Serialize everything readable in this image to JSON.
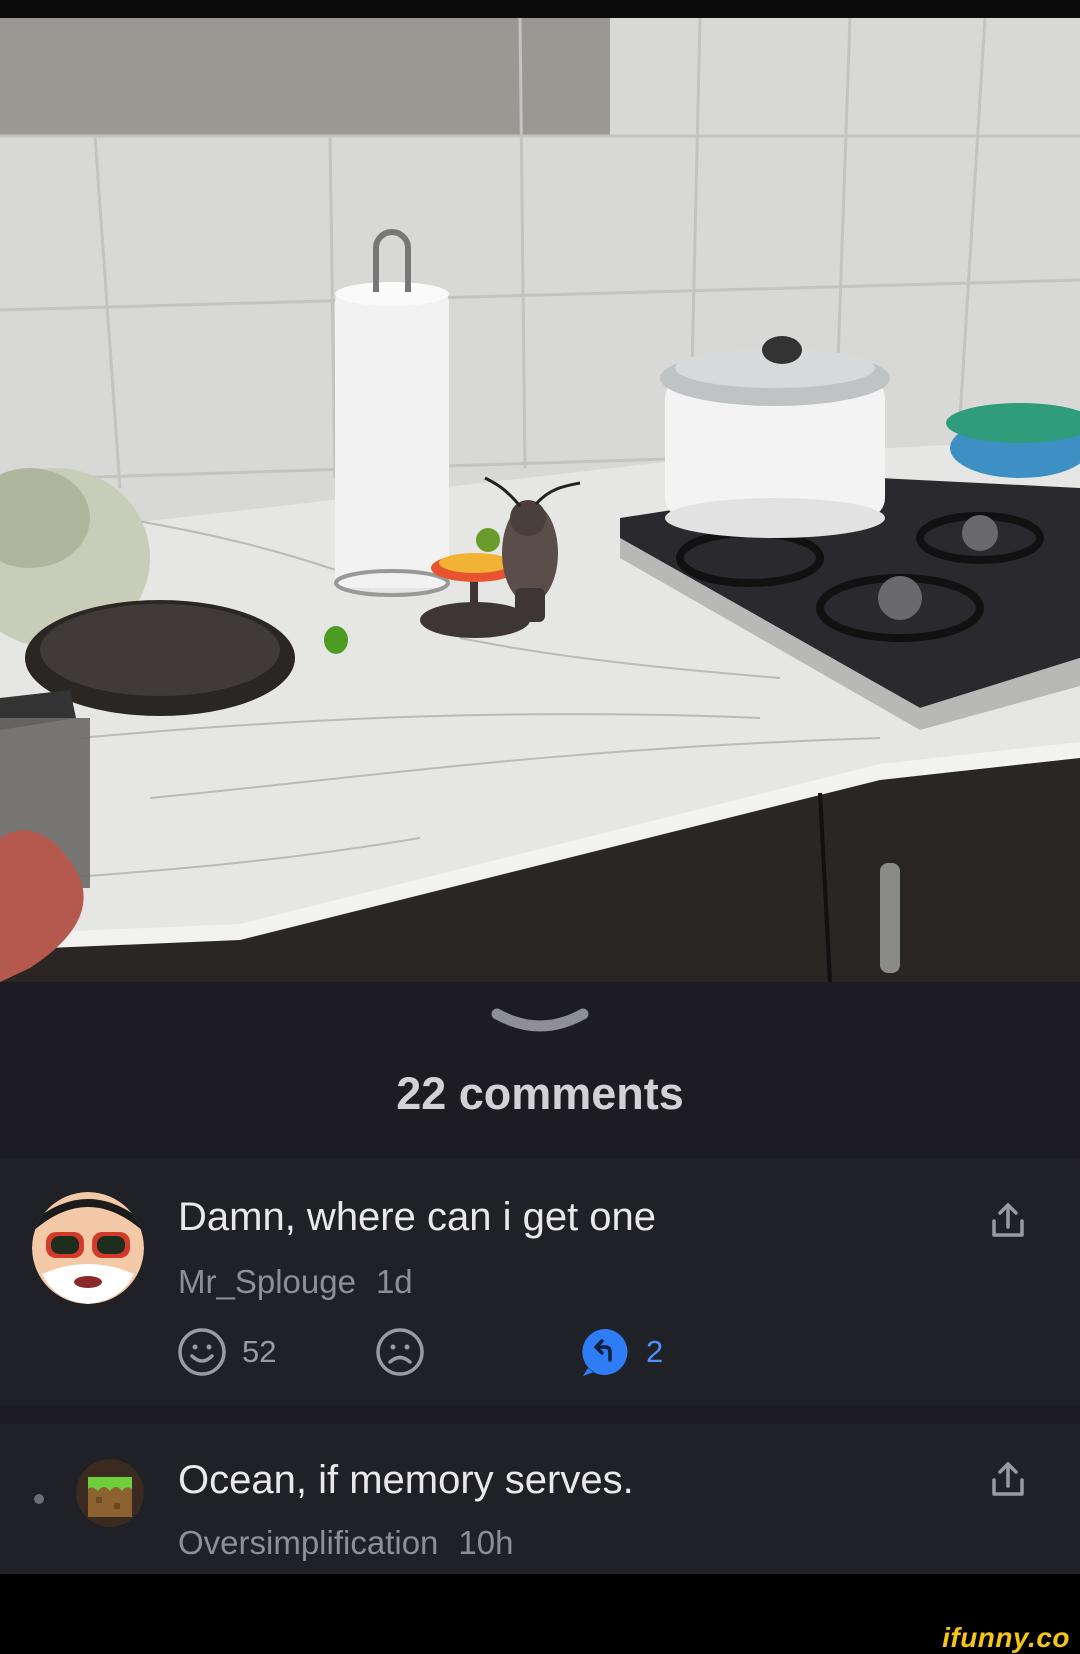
{
  "sheet": {
    "comments_count": "22 comments"
  },
  "comments": [
    {
      "text": "Damn, where can i get one",
      "username": "Mr_Splouge",
      "time": "1d",
      "likes": "52",
      "replies": "2"
    },
    {
      "text": "Ocean, if memory serves.",
      "username": "Oversimplification",
      "time": "10h"
    }
  ],
  "watermark": "ifunny.co",
  "colors": {
    "sheet_background": "#1c1c22",
    "comment_background": "#202027",
    "reply_accent": "#2f7df6",
    "watermark": "#f5c518"
  },
  "icons": {
    "grabber": "chevron-down-icon",
    "share": "share-icon",
    "like": "smile-icon",
    "dislike": "frown-icon",
    "reply": "reply-icon"
  }
}
